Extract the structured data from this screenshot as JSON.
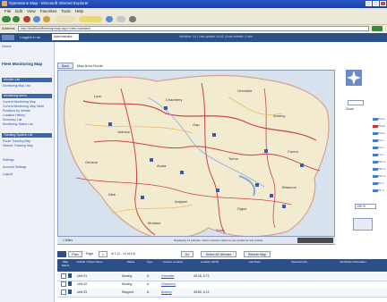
{
  "window": {
    "title": "Operations Map - Microsoft Internet Explorer"
  },
  "menu": [
    "File",
    "Edit",
    "View",
    "Favorites",
    "Tools",
    "Help"
  ],
  "address": {
    "label": "Address",
    "url": "http://localhost/fleetmap/map.aspx?view=standard"
  },
  "app_header": {
    "label": "Logged in as",
    "dropdown": "Administrator",
    "info": "Vehicles: 14 | Last update 10:42 | Auto refresh: 1 min"
  },
  "sidebar": {
    "home": "Home",
    "title": "Fleet Monitoring Map",
    "sections": [
      {
        "heading": "Monitor List",
        "links": [
          "Monitoring Map List"
        ]
      },
      {
        "heading": "Monitoring Items",
        "links": [
          "Current Monitoring Map",
          "Current Monitoring Map Table",
          "Positions by Vehicle",
          "Location History",
          "Summary List",
          "Monitoring Status List"
        ]
      },
      {
        "heading": "Tracking System List",
        "links": [
          "Route Tracking Map",
          "Historic Tracking Map"
        ]
      }
    ],
    "footer_links": [
      "Settings",
      "Account Settings",
      "Logout"
    ]
  },
  "map": {
    "back_button": "Back",
    "map_label": "Map Area  Route",
    "scale_label": "1 Miles",
    "status_text": "Displaying 14 vehicles. Click a vehicle marker to see details for this vehicle.",
    "cities": [
      "Lyon",
      "Chambery",
      "Grenoble",
      "Valence",
      "Gap",
      "Annecy",
      "Geneve",
      "Aosta",
      "Torino",
      "Cuneo",
      "Nice",
      "Avignon",
      "Digne",
      "Briancon",
      "Modane",
      "Susa"
    ]
  },
  "zoom": {
    "label": "Zoom",
    "levels": [
      "50 km",
      "25 km",
      "10 km",
      "5 km",
      "2 km",
      "1 km",
      "500 m",
      "250 m",
      "100 m",
      "50 m",
      "25 m"
    ],
    "select_value": "100 %"
  },
  "pager": {
    "prev": "Prev",
    "page_label": "Page",
    "page_value": "1",
    "of_text": "of 1 (1 - 14 of 14)",
    "go": "Go",
    "btn_select_all": "Select All Vehicles",
    "btn_refresh": "Refresh Map"
  },
  "table": {
    "headers": [
      "Map Select",
      "Vehicle / Driver Name",
      "Status",
      "Type",
      "Current Location",
      "Location (GPS)",
      "Last Data",
      "Speed (km/h)",
      "Alert/Note Information"
    ],
    "rows": [
      {
        "name": "Unit 01",
        "status": "Moving",
        "type": "A",
        "location": "Grenoble",
        "gps": "45.18, 5.72"
      },
      {
        "name": "Unit 02",
        "status": "Moving",
        "type": "A",
        "location": "Chambery",
        "gps": ""
      },
      {
        "name": "Unit 03",
        "status": "Stopped",
        "type": "A",
        "location": "Annecy",
        "gps": "45.89, 6.12"
      }
    ]
  },
  "colors": {
    "header_blue": "#2c4f86",
    "map_land": "#f3ebd0",
    "route_red": "#cc4444"
  }
}
